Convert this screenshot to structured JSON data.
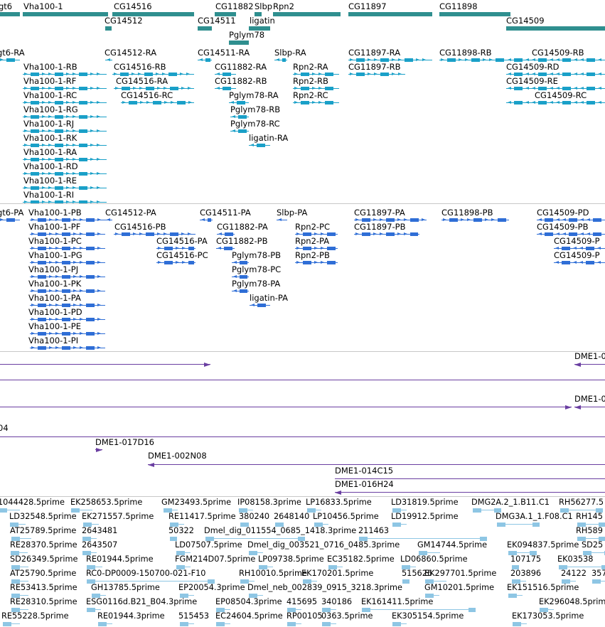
{
  "colors": {
    "gene": "#2f8f8f",
    "gene_arrow": "#2f8f8f",
    "transcript_rna": "#1aa0c8",
    "transcript_pep": "#2f6ed6",
    "clone": "#6a3ea1",
    "est": "#8ec6e4",
    "separator": "#c8c8c8"
  },
  "tracks": {
    "genes": {
      "items": [
        {
          "label": "gt6"
        },
        {
          "label": "Vha100-1"
        },
        {
          "label": "CG14516"
        },
        {
          "label": "CG14512"
        },
        {
          "label": "CG11882"
        },
        {
          "label": "CG14511"
        },
        {
          "label": "ligatin"
        },
        {
          "label": "Pglym78"
        },
        {
          "label": "Slbp"
        },
        {
          "label": "Rpn2"
        },
        {
          "label": "CG11897"
        },
        {
          "label": "CG11898"
        },
        {
          "label": "CG14509"
        }
      ]
    },
    "transcripts_rna": {
      "items": [
        {
          "label": "gt6-RA"
        },
        {
          "label": "Vha100-1-RB"
        },
        {
          "label": "Vha100-1-RF"
        },
        {
          "label": "Vha100-1-RC"
        },
        {
          "label": "Vha100-1-RG"
        },
        {
          "label": "Vha100-1-RJ"
        },
        {
          "label": "Vha100-1-RK"
        },
        {
          "label": "Vha100-1-RA"
        },
        {
          "label": "Vha100-1-RD"
        },
        {
          "label": "Vha100-1-RE"
        },
        {
          "label": "Vha100-1-RI"
        },
        {
          "label": "CG14512-RA"
        },
        {
          "label": "CG14516-RB"
        },
        {
          "label": "CG14516-RA"
        },
        {
          "label": "CG14516-RC"
        },
        {
          "label": "CG14511-RA"
        },
        {
          "label": "CG11882-RA"
        },
        {
          "label": "CG11882-RB"
        },
        {
          "label": "Pglym78-RA"
        },
        {
          "label": "Pglym78-RB"
        },
        {
          "label": "Pglym78-RC"
        },
        {
          "label": "ligatin-RA"
        },
        {
          "label": "Slbp-RA"
        },
        {
          "label": "Rpn2-RA"
        },
        {
          "label": "Rpn2-RB"
        },
        {
          "label": "Rpn2-RC"
        },
        {
          "label": "CG11897-RA"
        },
        {
          "label": "CG11897-RB"
        },
        {
          "label": "CG11898-RB"
        },
        {
          "label": "CG14509-RB"
        },
        {
          "label": "CG14509-RD"
        },
        {
          "label": "CG14509-RE"
        },
        {
          "label": "CG14509-RC"
        }
      ]
    },
    "transcripts_pep": {
      "items": [
        {
          "label": "gt6-PA"
        },
        {
          "label": "Vha100-1-PB"
        },
        {
          "label": "Vha100-1-PF"
        },
        {
          "label": "Vha100-1-PC"
        },
        {
          "label": "Vha100-1-PG"
        },
        {
          "label": "Vha100-1-PJ"
        },
        {
          "label": "Vha100-1-PK"
        },
        {
          "label": "Vha100-1-PA"
        },
        {
          "label": "Vha100-1-PD"
        },
        {
          "label": "Vha100-1-PE"
        },
        {
          "label": "Vha100-1-PI"
        },
        {
          "label": "CG14512-PA"
        },
        {
          "label": "CG14516-PB"
        },
        {
          "label": "CG14516-PA"
        },
        {
          "label": "CG14516-PC"
        },
        {
          "label": "CG14511-PA"
        },
        {
          "label": "CG11882-PA"
        },
        {
          "label": "CG11882-PB"
        },
        {
          "label": "Pglym78-PB"
        },
        {
          "label": "Pglym78-PC"
        },
        {
          "label": "Pglym78-PA"
        },
        {
          "label": "ligatin-PA"
        },
        {
          "label": "Slbp-PA"
        },
        {
          "label": "Rpn2-PC"
        },
        {
          "label": "Rpn2-PA"
        },
        {
          "label": "Rpn2-PB"
        },
        {
          "label": "CG11897-PA"
        },
        {
          "label": "CG11897-PB"
        },
        {
          "label": "CG11898-PB"
        },
        {
          "label": "CG14509-PD"
        },
        {
          "label": "CG14509-PB"
        },
        {
          "label": "CG14509-P"
        },
        {
          "label": "CG14509-P"
        }
      ]
    },
    "clones": {
      "items": [
        {
          "label": "DME1-0"
        },
        {
          "label": "DME1-0"
        },
        {
          "label": "04"
        },
        {
          "label": "DME1-017D16"
        },
        {
          "label": "DME1-002N08"
        },
        {
          "label": "DME1-014C15"
        },
        {
          "label": "DME1-016H24"
        }
      ]
    },
    "ests": {
      "items": [
        {
          "label": "1044428.5prime"
        },
        {
          "label": "EK258653.5prime"
        },
        {
          "label": "GM23493.5prime"
        },
        {
          "label": "IP08158.3prime"
        },
        {
          "label": "LP16833.5prime"
        },
        {
          "label": "LD31819.5prime"
        },
        {
          "label": "DMG2A.2_1.B11.C1"
        },
        {
          "label": "RH56277.5"
        },
        {
          "label": "LD32548.5prime"
        },
        {
          "label": "EK271557.5prime"
        },
        {
          "label": "RE11417.5prime"
        },
        {
          "label": "380240"
        },
        {
          "label": "2648140"
        },
        {
          "label": "LP10456.5prime"
        },
        {
          "label": "LD19912.5prime"
        },
        {
          "label": "DMG3A.1_1.F08.C1"
        },
        {
          "label": "RH145"
        },
        {
          "label": "AT25789.5prime"
        },
        {
          "label": "2643481"
        },
        {
          "label": "50322"
        },
        {
          "label": "Dmel_dig_011554_0685_1418.3prime"
        },
        {
          "label": "211463"
        },
        {
          "label": "RH589"
        },
        {
          "label": "RE28370.5prime"
        },
        {
          "label": "2643507"
        },
        {
          "label": "LD07507.5prime"
        },
        {
          "label": "Dmel_dig_003521_0716_0485.3prime"
        },
        {
          "label": "GM14744.5prime"
        },
        {
          "label": "EK094837.5prime"
        },
        {
          "label": "SD25"
        },
        {
          "label": "SD26349.5prime"
        },
        {
          "label": "RE01944.5prime"
        },
        {
          "label": "FGM214D07.5prime"
        },
        {
          "label": "LP09738.5prime"
        },
        {
          "label": "EC35182.5prime"
        },
        {
          "label": "LD06860.5prime"
        },
        {
          "label": "107175"
        },
        {
          "label": "EK03538"
        },
        {
          "label": "AT25790.5prime"
        },
        {
          "label": "RC0-DP0009-150700-021-F10"
        },
        {
          "label": "RH10010.5prime"
        },
        {
          "label": "EK170201.5prime"
        },
        {
          "label": "515626"
        },
        {
          "label": "EK297701.5prime"
        },
        {
          "label": "203896"
        },
        {
          "label": "24122"
        },
        {
          "label": "357"
        },
        {
          "label": "RE53413.5prime"
        },
        {
          "label": "GH13785.5prime"
        },
        {
          "label": "EP20054.3prime"
        },
        {
          "label": "Dmel_neb_002839_0915_3218.3prime"
        },
        {
          "label": "GM10201.5prime"
        },
        {
          "label": "EK151516.5prime"
        },
        {
          "label": "RE28310.5prime"
        },
        {
          "label": "ESG0116d.B21_B04.3prime"
        },
        {
          "label": "EP08504.3prime"
        },
        {
          "label": "415695"
        },
        {
          "label": "340186"
        },
        {
          "label": "EK161411.5prime"
        },
        {
          "label": "EK296048.5prime"
        },
        {
          "label": "RE55228.5prime"
        },
        {
          "label": "RE01944.3prime"
        },
        {
          "label": "515453"
        },
        {
          "label": "EC24604.5prime"
        },
        {
          "label": "RP00105"
        },
        {
          "label": "0363.5prime"
        },
        {
          "label": "EK305154.5prime"
        },
        {
          "label": "EK173053.5prime"
        }
      ]
    }
  }
}
